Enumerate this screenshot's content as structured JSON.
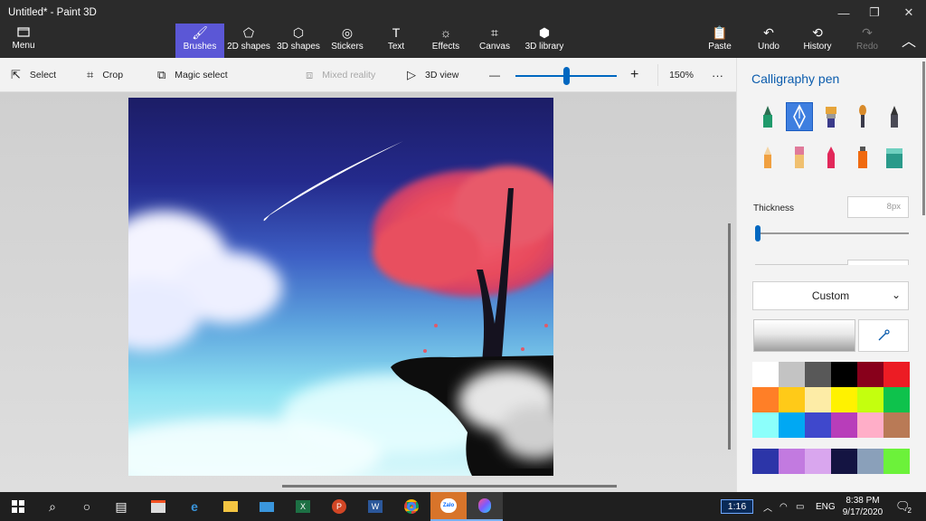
{
  "window": {
    "title": "Untitled* - Paint 3D",
    "minimize_glyph": "—",
    "maximize_glyph": "❐",
    "close_glyph": "✕"
  },
  "ribbon": {
    "menu_label": "Menu",
    "tools": [
      {
        "label": "Brushes",
        "icon": "brush-icon",
        "active": true
      },
      {
        "label": "2D shapes",
        "icon": "2d-shapes-icon"
      },
      {
        "label": "3D shapes",
        "icon": "3d-shapes-icon"
      },
      {
        "label": "Stickers",
        "icon": "stickers-icon"
      },
      {
        "label": "Text",
        "icon": "text-icon"
      },
      {
        "label": "Effects",
        "icon": "effects-icon"
      },
      {
        "label": "Canvas",
        "icon": "canvas-icon"
      },
      {
        "label": "3D library",
        "icon": "3d-library-icon"
      }
    ],
    "right": [
      {
        "label": "Paste",
        "icon": "paste-icon"
      },
      {
        "label": "Undo",
        "icon": "undo-icon"
      },
      {
        "label": "History",
        "icon": "history-icon"
      },
      {
        "label": "Redo",
        "icon": "redo-icon",
        "disabled": true
      }
    ]
  },
  "toolbar": {
    "select": "Select",
    "crop": "Crop",
    "magic_select": "Magic select",
    "mixed_reality": "Mixed reality",
    "view_3d": "3D view",
    "zoom_minus": "—",
    "zoom_plus": "+",
    "zoom_value": "150%",
    "more": "···"
  },
  "zoom_slider_fraction": 0.5,
  "panel": {
    "title": "Calligraphy pen",
    "brushes": [
      {
        "name": "marker",
        "color": "#1f9a6b"
      },
      {
        "name": "calligraphy-pen",
        "color": "#ffffff",
        "selected": true
      },
      {
        "name": "oil-brush",
        "color": "#e6a43a"
      },
      {
        "name": "watercolor",
        "color": "#d88a2a"
      },
      {
        "name": "pixel-pen",
        "color": "#4a4a55"
      },
      {
        "name": "pencil",
        "color": "#f0a040"
      },
      {
        "name": "eraser",
        "color": "#e07a9a"
      },
      {
        "name": "crayon",
        "color": "#e2285a"
      },
      {
        "name": "spray-can",
        "color": "#f06a10"
      },
      {
        "name": "fill",
        "color": "#2a9a8a"
      }
    ],
    "thickness_label": "Thickness",
    "thickness_value": "8px",
    "thickness_fraction": 0.02,
    "color_dropdown": "Custom",
    "palette": [
      "#ffffff",
      "#c3c3c3",
      "#585858",
      "#000000",
      "#88001b",
      "#ec1c24",
      "#ff7f27",
      "#ffca18",
      "#fdeca6",
      "#fff200",
      "#c4ff0e",
      "#0ec24c",
      "#8cfffb",
      "#00a8f3",
      "#3f48cc",
      "#b83dba",
      "#ffaec8",
      "#b97a56"
    ],
    "palette_custom": [
      "#2c35a8",
      "#c27ae0",
      "#d9a6ee",
      "#141442",
      "#8aa0ba",
      "#6cf23a"
    ]
  },
  "taskbar": {
    "clock_box": "1:16",
    "lang": "ENG",
    "time": "8:38 PM",
    "date": "9/17/2020",
    "notifications": "2",
    "apps": [
      "start-icon",
      "search-icon",
      "cortana-icon",
      "task-view-icon",
      "store-icon",
      "edge-icon",
      "file-explorer-icon",
      "mail-icon",
      "excel-icon",
      "powerpoint-icon",
      "word-icon",
      "chrome-icon",
      "zalo-icon",
      "paint3d-icon"
    ]
  }
}
